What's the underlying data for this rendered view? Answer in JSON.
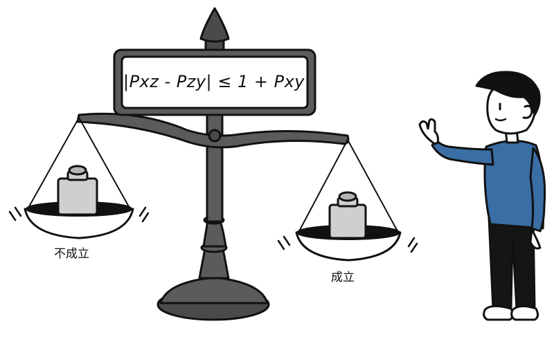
{
  "sign": {
    "formula": "|Pxz - Pzy| ≤ 1 + Pxy"
  },
  "labels": {
    "left_pan": "不成立",
    "right_pan": "成立"
  },
  "colors": {
    "metal": "#5b5b5b",
    "metal_dark": "#3d3d3d",
    "weight": "#cfcfcf",
    "shirt": "#3a6ea5",
    "pants": "#151515",
    "outline": "#111111"
  },
  "icons": [
    "balance-scale-icon",
    "weight-icon",
    "person-icon",
    "waving-hand-icon"
  ]
}
